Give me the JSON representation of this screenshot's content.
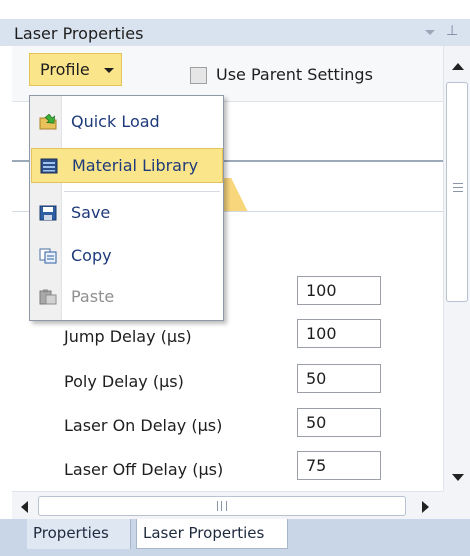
{
  "window": {
    "title": "Laser Properties"
  },
  "toolbar": {
    "profile_label": "Profile",
    "use_parent_label": "Use Parent Settings",
    "use_parent_checked": false
  },
  "profile_menu": {
    "items": [
      {
        "label": "Quick Load",
        "icon": "folder-load-icon",
        "state": "normal"
      },
      {
        "label": "Material Library",
        "icon": "book-icon",
        "state": "highlighted"
      },
      {
        "label": "Save",
        "icon": "floppy-disk-icon",
        "state": "normal"
      },
      {
        "label": "Copy",
        "icon": "copy-icon",
        "state": "normal"
      },
      {
        "label": "Paste",
        "icon": "paste-icon",
        "state": "disabled"
      }
    ]
  },
  "fields": [
    {
      "label": "",
      "value": "100"
    },
    {
      "label": "Jump Delay (µs)",
      "value": "100"
    },
    {
      "label": "Poly Delay (µs)",
      "value": "50"
    },
    {
      "label": "Laser On Delay (µs)",
      "value": "50"
    },
    {
      "label": "Laser Off Delay (µs)",
      "value": "75"
    }
  ],
  "bottom_tabs": [
    {
      "label": "Properties",
      "active": false
    },
    {
      "label": "Laser Properties",
      "active": true
    }
  ],
  "colors": {
    "accent": "#fbe58a",
    "titlebar": "#d9e3ef",
    "tabsbar": "#c9d6e8"
  }
}
